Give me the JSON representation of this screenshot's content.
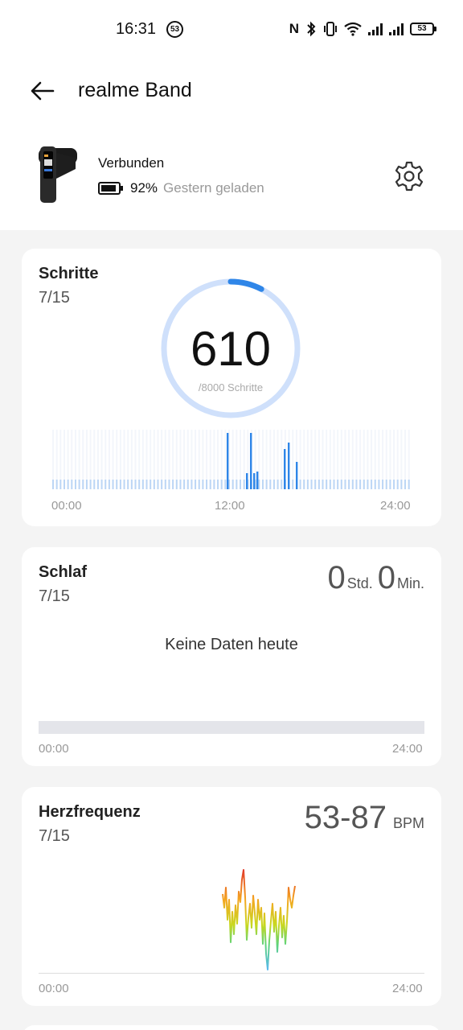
{
  "status_bar": {
    "time": "16:31",
    "notification_count": "53",
    "battery": "53"
  },
  "header": {
    "title": "realme Band"
  },
  "device": {
    "status": "Verbunden",
    "battery_percent": "92%",
    "charged_text": "Gestern geladen"
  },
  "steps": {
    "title": "Schritte",
    "date": "7/15",
    "value": "610",
    "goal_text": "/8000 Schritte",
    "progress": 0.076,
    "axis": {
      "start": "00:00",
      "mid": "12:00",
      "end": "24:00"
    }
  },
  "sleep": {
    "title": "Schlaf",
    "date": "7/15",
    "hours": "0",
    "hours_unit": "Std.",
    "minutes": "0",
    "minutes_unit": "Min.",
    "empty_text": "Keine Daten heute",
    "axis": {
      "start": "00:00",
      "end": "24:00"
    }
  },
  "heart_rate": {
    "title": "Herzfrequenz",
    "date": "7/15",
    "range": "53-87",
    "unit": "BPM",
    "axis": {
      "start": "00:00",
      "end": "24:00"
    }
  },
  "colors": {
    "accent_blue": "#2f86e8",
    "ring_track": "#cfe0fb",
    "text_gray": "#999999"
  },
  "icons": [
    "back-arrow-icon",
    "gear-icon",
    "bluetooth-icon",
    "nfc-icon",
    "wifi-icon",
    "vibrate-icon",
    "battery-icon"
  ]
}
